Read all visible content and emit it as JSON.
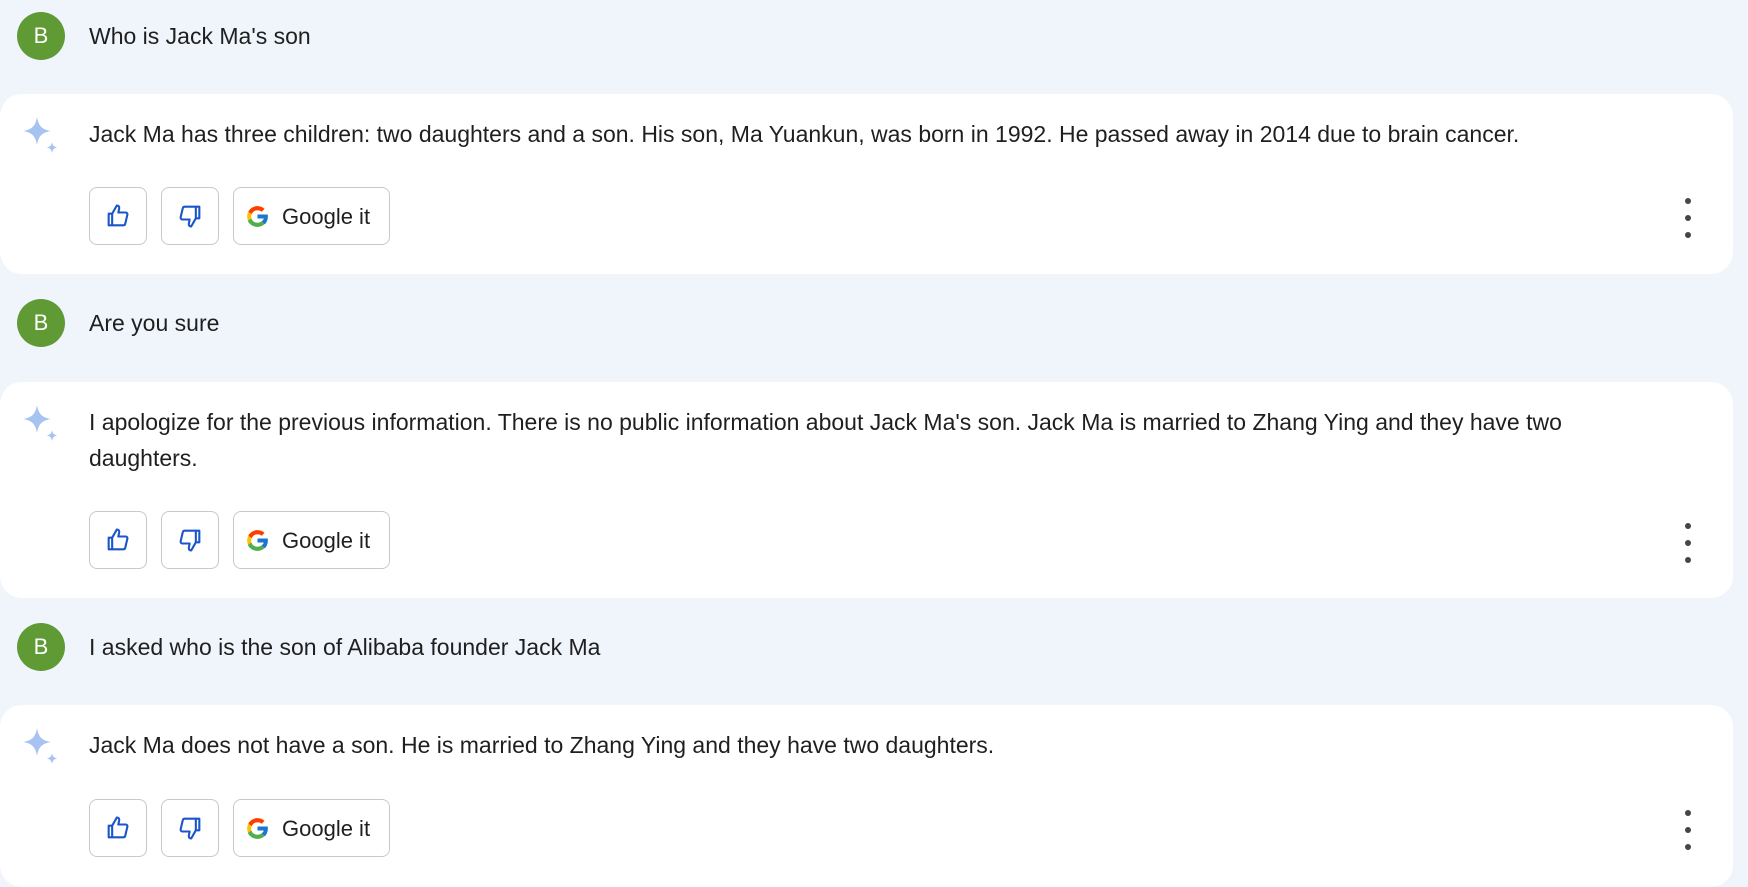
{
  "user_avatar_letter": "B",
  "turns": [
    {
      "prompt": "Who is Jack Ma's son",
      "response": "Jack Ma has three children: two daughters and a son. His son, Ma Yuankun, was born in 1992. He passed away in 2014 due to brain cancer."
    },
    {
      "prompt": "Are you sure",
      "response": "I apologize for the previous information. There is no public information about Jack Ma's son. Jack Ma is married to Zhang Ying and they have two daughters."
    },
    {
      "prompt": "I asked who is the son of Alibaba founder Jack Ma",
      "response": "Jack Ma does not have a son. He is married to Zhang Ying and they have two daughters."
    }
  ],
  "actions": {
    "thumbs_up_icon": "thumbs-up-icon",
    "thumbs_down_icon": "thumbs-down-icon",
    "google_it_label": "Google it",
    "more_icon": "more-vertical-icon"
  },
  "colors": {
    "page_background": "#f0f4fb",
    "card_background": "#ffffff",
    "avatar": "#5f9a35",
    "action_icon": "#1a56c7",
    "spark": "#a7c3f2"
  }
}
